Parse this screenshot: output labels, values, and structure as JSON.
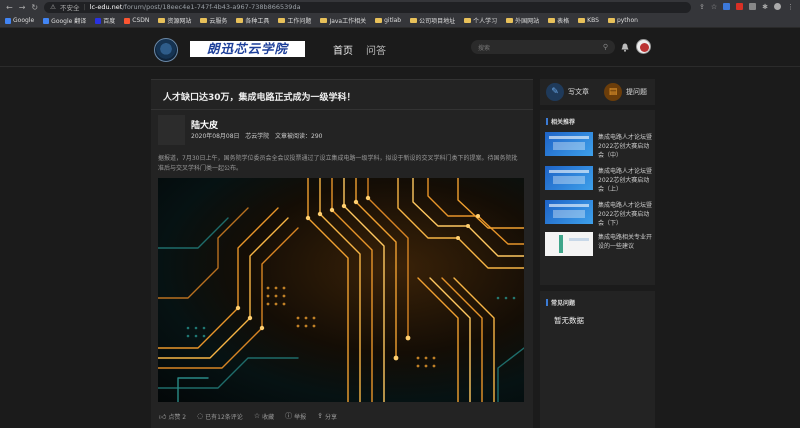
{
  "browser": {
    "security": "不安全",
    "host": "lc-edu.net",
    "path": "/forum/post/18eec4e1-747f-4b43-a967-738b866539da",
    "nav_icons": [
      "back-icon",
      "forward-icon",
      "reload-icon"
    ]
  },
  "bookmarks": [
    {
      "label": "Google",
      "icon": "google-icon",
      "color": "#4285f4"
    },
    {
      "label": "Google 翻译",
      "icon": "translate-icon",
      "color": "#4285f4"
    },
    {
      "label": "百度",
      "icon": "baidu-icon",
      "color": "#2932e1"
    },
    {
      "label": "CSDN",
      "icon": "csdn-icon",
      "color": "#fc5531"
    },
    {
      "label": "资源网站",
      "icon": "folder-icon"
    },
    {
      "label": "云服务",
      "icon": "folder-icon"
    },
    {
      "label": "各种工具",
      "icon": "folder-icon"
    },
    {
      "label": "工作问题",
      "icon": "folder-icon"
    },
    {
      "label": "Java工作相关",
      "icon": "folder-icon"
    },
    {
      "label": "gitlab",
      "icon": "folder-icon"
    },
    {
      "label": "公司项目地址",
      "icon": "folder-icon"
    },
    {
      "label": "个人学习",
      "icon": "folder-icon"
    },
    {
      "label": "外国网站",
      "icon": "folder-icon"
    },
    {
      "label": "表格",
      "icon": "folder-icon"
    },
    {
      "label": "KBS",
      "icon": "folder-icon"
    },
    {
      "label": "python",
      "icon": "folder-icon"
    }
  ],
  "header": {
    "logo_text": "朗迅芯云学院",
    "nav": {
      "home": "首页",
      "qa": "问答"
    },
    "search_placeholder": "搜索"
  },
  "article": {
    "title": "人才缺口达30万，集成电路正式成为一级学科！",
    "author": "陆大皮",
    "date": "2020年08月08日",
    "school": "芯云学院",
    "views_label": "文章被阅读：",
    "views": "290",
    "body": "据报道，7月30日上午，国务院学位委员会全会议投票通过了设立集成电路一级学科，拟设于新设的交叉学科门类下的提案。待国务院批准后与交叉学科门类一起公布。",
    "actions": {
      "like": "点赞 2",
      "comments": "已有12条评论",
      "favorite": "收藏",
      "report": "举报",
      "share": "分享"
    }
  },
  "sidebar": {
    "write": "写文章",
    "ask": "提问题",
    "rec_title": "相关推荐",
    "recommendations": [
      {
        "title": "集成电路人才论坛暨2022芯创大赛启动会（中）"
      },
      {
        "title": "集成电路人才论坛暨2022芯创大赛启动会（上）"
      },
      {
        "title": "集成电路人才论坛暨2022芯创大赛启动会（下）"
      },
      {
        "title": "集成电路相关专业开设的一些建议"
      }
    ],
    "faq_title": "常见问题",
    "faq_empty": "暂无数据"
  },
  "colors": {
    "accent": "#3b7bd6",
    "write_icon_bg": "#1f3a5a",
    "ask_icon_bg": "#6b3d0a"
  }
}
